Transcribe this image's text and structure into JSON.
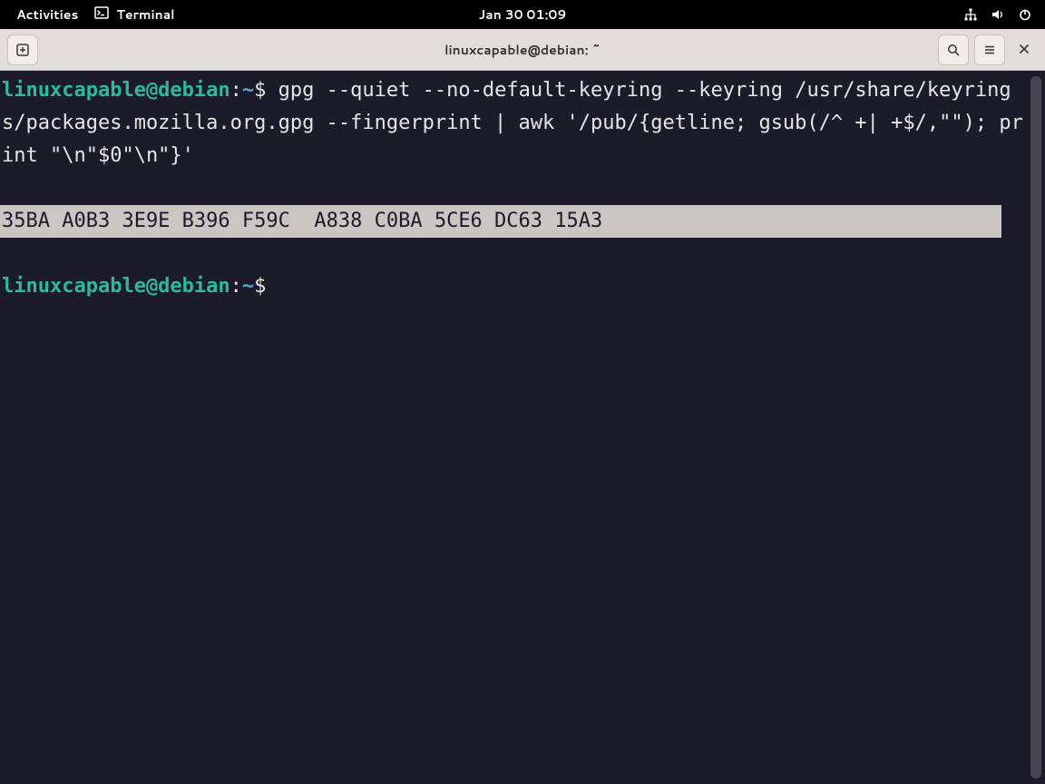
{
  "topbar": {
    "activities": "Activities",
    "app_label": "Terminal",
    "datetime": "Jan 30  01:09"
  },
  "titlebar": {
    "title": "linuxcapable@debian: ~"
  },
  "terminal": {
    "prompt_user": "linuxcapable@debian",
    "prompt_colon": ":",
    "prompt_tilde": "~",
    "prompt_dollar": "$",
    "command": " gpg --quiet --no-default-keyring --keyring /usr/share/keyrings/packages.mozilla.org.gpg --fingerprint | awk '/pub/{getline; gsub(/^ +| +$/,\"\"); print \"\\n\"$0\"\\n\"}'",
    "fingerprint": "35BA A0B3 3E9E B396 F59C  A838 C0BA 5CE6 DC63 15A3"
  }
}
